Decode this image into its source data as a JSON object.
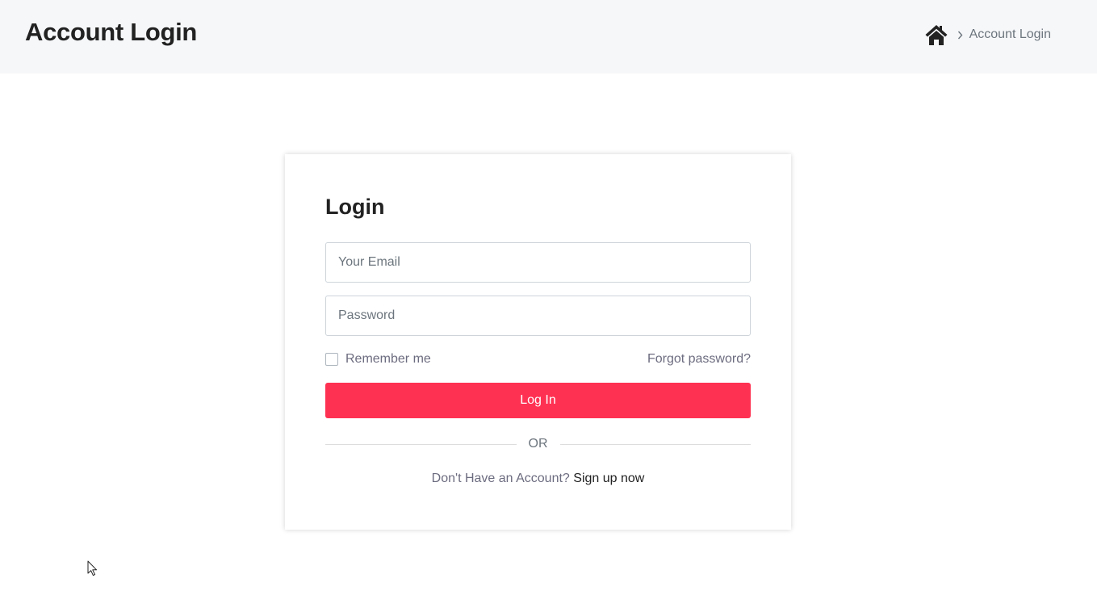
{
  "header": {
    "title": "Account Login",
    "breadcrumb": {
      "home_icon": "home-icon",
      "separator_icon": "chevron-right-icon",
      "current": "Account Login"
    }
  },
  "login_form": {
    "title": "Login",
    "email_placeholder": "Your Email",
    "password_placeholder": "Password",
    "remember_label": "Remember me",
    "forgot_password": "Forgot password?",
    "submit_label": "Log In",
    "divider_text": "OR",
    "signup_prompt": "Don't Have an Account?",
    "signup_link": "Sign up now"
  },
  "colors": {
    "header_bg": "#f6f7f9",
    "accent": "#ff3152"
  }
}
